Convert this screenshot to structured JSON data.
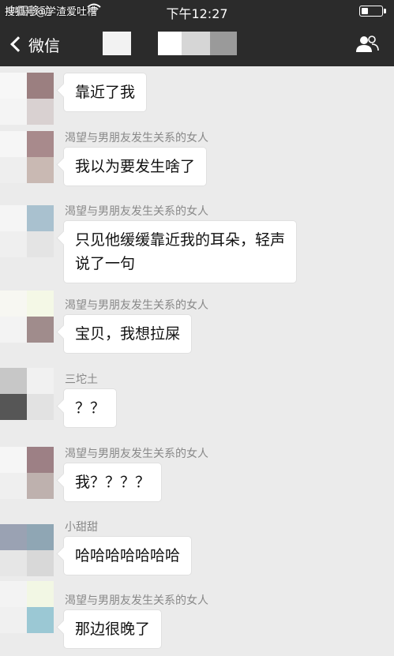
{
  "status_bar": {
    "carrier": "中国移动",
    "time": "下午12:27",
    "battery_level": 0.35
  },
  "watermark": "搜狐号@学渣爱吐槽",
  "nav": {
    "back_label": "微信",
    "back_icon": "chevron-left-icon",
    "contacts_icon": "group-icon"
  },
  "messages": [
    {
      "sender": "",
      "text": "靠近了我"
    },
    {
      "sender": "渴望与男朋友发生关系的女人",
      "text": "我以为要发生啥了"
    },
    {
      "sender": "渴望与男朋友发生关系的女人",
      "text": "只见他缓缓靠近我的耳朵，轻声\n说了一句"
    },
    {
      "sender": "渴望与男朋友发生关系的女人",
      "text": "宝贝，我想拉屎"
    },
    {
      "sender": "三坨土",
      "text": "？？"
    },
    {
      "sender": "渴望与男朋友发生关系的女人",
      "text": "我？？？？"
    },
    {
      "sender": "小甜甜",
      "text": "哈哈哈哈哈哈哈"
    },
    {
      "sender": "渴望与男朋友发生关系的女人",
      "text": "那边很晚了"
    }
  ],
  "colors": {
    "nav_background": "#2b2b2b",
    "chat_background": "#ebebeb",
    "bubble": "#ffffff",
    "sender_text": "#888888"
  }
}
